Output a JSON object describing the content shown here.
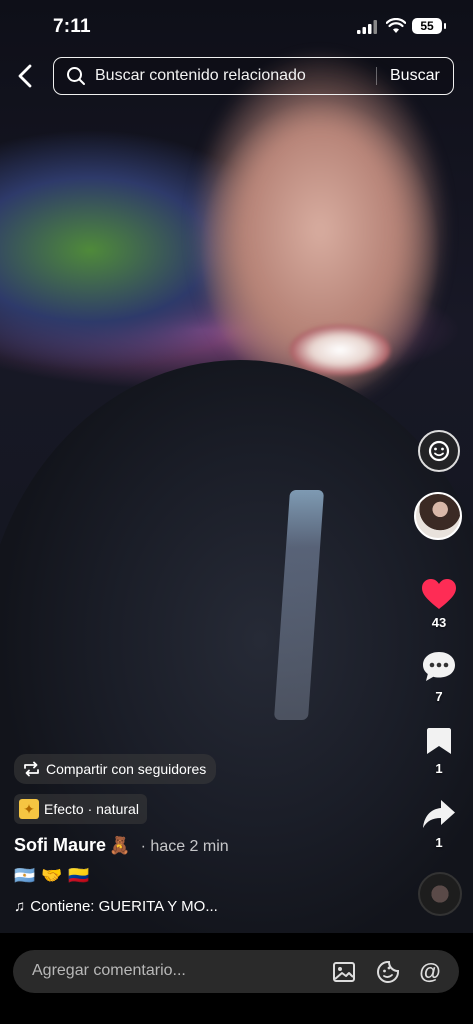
{
  "status_bar": {
    "time": "7:11",
    "battery": "55"
  },
  "search": {
    "placeholder": "Buscar contenido relacionado",
    "submit_label": "Buscar"
  },
  "actions": {
    "likes": "43",
    "comments": "7",
    "saves": "1",
    "shares": "1"
  },
  "post": {
    "share_with_followers": "Compartir con seguidores",
    "effect_label": "Efecto · natural",
    "username": "Sofi Maure",
    "username_emoji": "🧸",
    "timestamp": "· hace 2 min",
    "caption_emojis": "🇦🇷🤝🇨🇴",
    "music_label": "Contiene: GUERITA Y MO..."
  },
  "comment_bar": {
    "placeholder": "Agregar comentario..."
  },
  "colors": {
    "like": "#fe2c55",
    "bar_bg": "#000000",
    "input_bg": "#2a2a2a"
  }
}
